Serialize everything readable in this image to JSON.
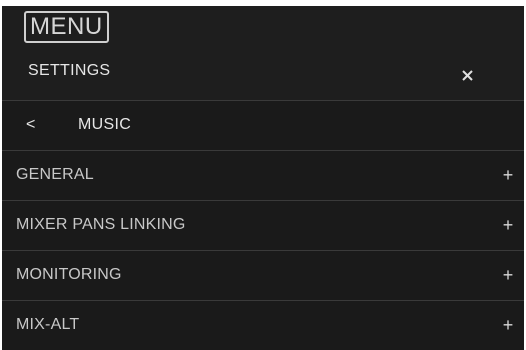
{
  "menu": {
    "label": "MENU"
  },
  "header": {
    "title": "SETTINGS",
    "close_icon": "close-icon"
  },
  "breadcrumb": {
    "back_glyph": "<",
    "label": "MUSIC"
  },
  "sections": [
    {
      "label": "GENERAL",
      "expand_glyph": "+"
    },
    {
      "label": "MIXER PANS LINKING",
      "expand_glyph": "+"
    },
    {
      "label": "MONITORING",
      "expand_glyph": "+"
    },
    {
      "label": "MIX-ALT",
      "expand_glyph": "+"
    }
  ],
  "colors": {
    "panel_bg": "#1e1e1e",
    "row_bg": "#1a1a1a",
    "divider": "#3a3a3a",
    "text": "#e0e0e0"
  }
}
